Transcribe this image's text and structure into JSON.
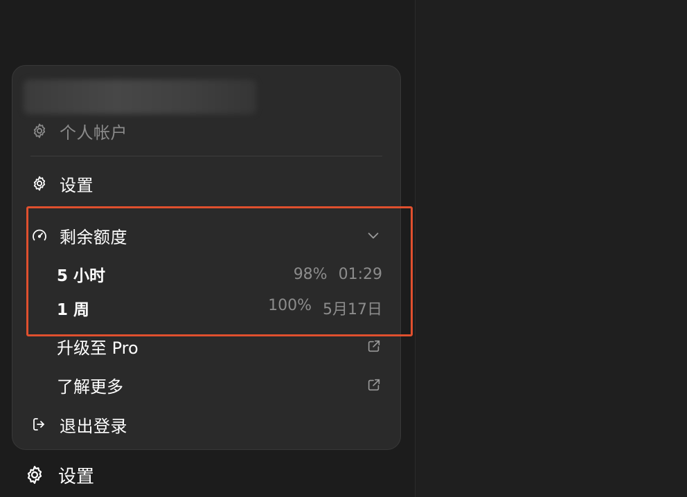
{
  "menu": {
    "account_label": "个人帐户",
    "settings_label": "设置",
    "quota": {
      "label": "剩余额度",
      "rows": [
        {
          "name": "5 小时",
          "percent": "98%",
          "reset": "01:29"
        },
        {
          "name": "1 周",
          "percent": "100%",
          "reset": "5月17日"
        }
      ]
    },
    "upgrade_label": "升级至 Pro",
    "learn_more_label": "了解更多",
    "logout_label": "退出登录"
  },
  "sidebar": {
    "settings_label": "设置"
  },
  "icons": {
    "account": "gear-icon",
    "settings": "gear-icon",
    "quota": "gauge-icon",
    "expand": "chevron-down-icon",
    "external": "external-link-icon",
    "logout": "logout-icon"
  },
  "colors": {
    "highlight": "#e0502e",
    "menu_bg": "#2a2a2a",
    "page_bg": "#1c1c1c",
    "muted_text": "#8c8c8c"
  }
}
